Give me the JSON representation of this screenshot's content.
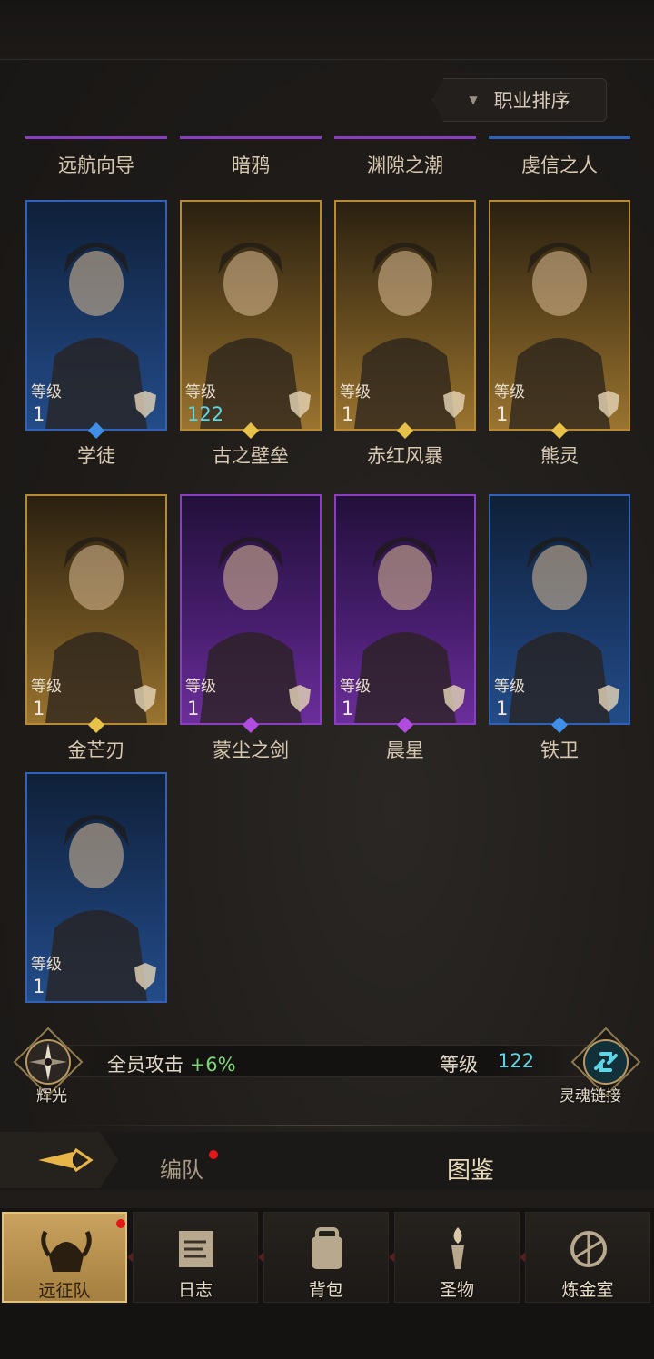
{
  "sort": {
    "label": "职业排序",
    "arrow": "▼"
  },
  "top_labels": [
    "远航向导",
    "暗鸦",
    "渊隙之潮",
    "虔信之人"
  ],
  "level_caption": "等级",
  "rows": [
    [
      {
        "name": "学徒",
        "level": "1",
        "color": "blue"
      },
      {
        "name": "古之壁垒",
        "level": "122",
        "color": "gold",
        "highlight": true
      },
      {
        "name": "赤红风暴",
        "level": "1",
        "color": "gold"
      },
      {
        "name": "熊灵",
        "level": "1",
        "color": "gold"
      }
    ],
    [
      {
        "name": "金芒刃",
        "level": "1",
        "color": "gold"
      },
      {
        "name": "蒙尘之剑",
        "level": "1",
        "color": "purple"
      },
      {
        "name": "晨星",
        "level": "1",
        "color": "purple"
      },
      {
        "name": "铁卫",
        "level": "1",
        "color": "blue"
      }
    ],
    [
      {
        "name": "",
        "level": "1",
        "color": "blue"
      }
    ]
  ],
  "bonus": {
    "glory_label": "辉光",
    "text": "全员攻击",
    "value": "+6%",
    "value_color": "#7ed67a",
    "level_label": "等级",
    "level_value": "122",
    "soul_label": "灵魂链接"
  },
  "tabs": {
    "formation": "编队",
    "codex": "图鉴"
  },
  "nav": [
    {
      "label": "远征队",
      "icon": "viking-helmet-icon",
      "active": true,
      "badge": true
    },
    {
      "label": "日志",
      "icon": "scroll-icon",
      "active": false
    },
    {
      "label": "背包",
      "icon": "backpack-icon",
      "active": false
    },
    {
      "label": "圣物",
      "icon": "relic-torch-icon",
      "active": false
    },
    {
      "label": "炼金室",
      "icon": "alchemy-icon",
      "active": false
    }
  ],
  "colors": {
    "blue": "#2f62b8",
    "gold": "#b88a34",
    "purple": "#8a3fc0",
    "accent_cyan": "#5fd6e6"
  }
}
